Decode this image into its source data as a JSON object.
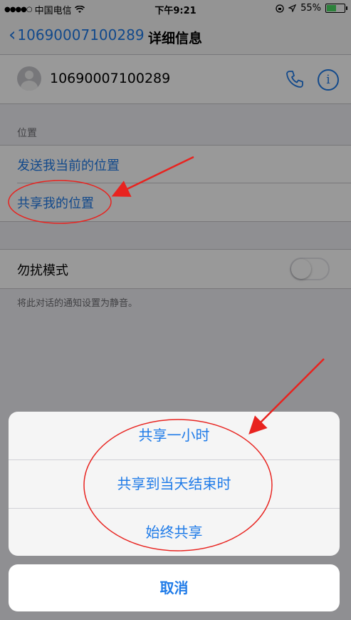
{
  "status_bar": {
    "carrier": "中国电信",
    "time": "下午9:21",
    "battery_percent": "55%",
    "battery_level": 0.55
  },
  "nav": {
    "back_label": "10690007100289",
    "title": "详细信息"
  },
  "contact": {
    "number": "10690007100289"
  },
  "location_section": {
    "header": "位置",
    "send_location": "发送我当前的位置",
    "share_location": "共享我的位置"
  },
  "dnd": {
    "label": "勿扰模式",
    "enabled": false,
    "note": "将此对话的通知设置为静音。"
  },
  "action_sheet": {
    "options": [
      "共享一小时",
      "共享到当天结束时",
      "始终共享"
    ],
    "cancel": "取消"
  },
  "colors": {
    "accent": "#1f7be8",
    "annotation": "#e8231f"
  },
  "icons": [
    "back-chevron-icon",
    "wifi-icon",
    "lock-rotation-icon",
    "location-arrow-icon",
    "battery-icon",
    "avatar-icon",
    "phone-icon",
    "info-icon"
  ]
}
